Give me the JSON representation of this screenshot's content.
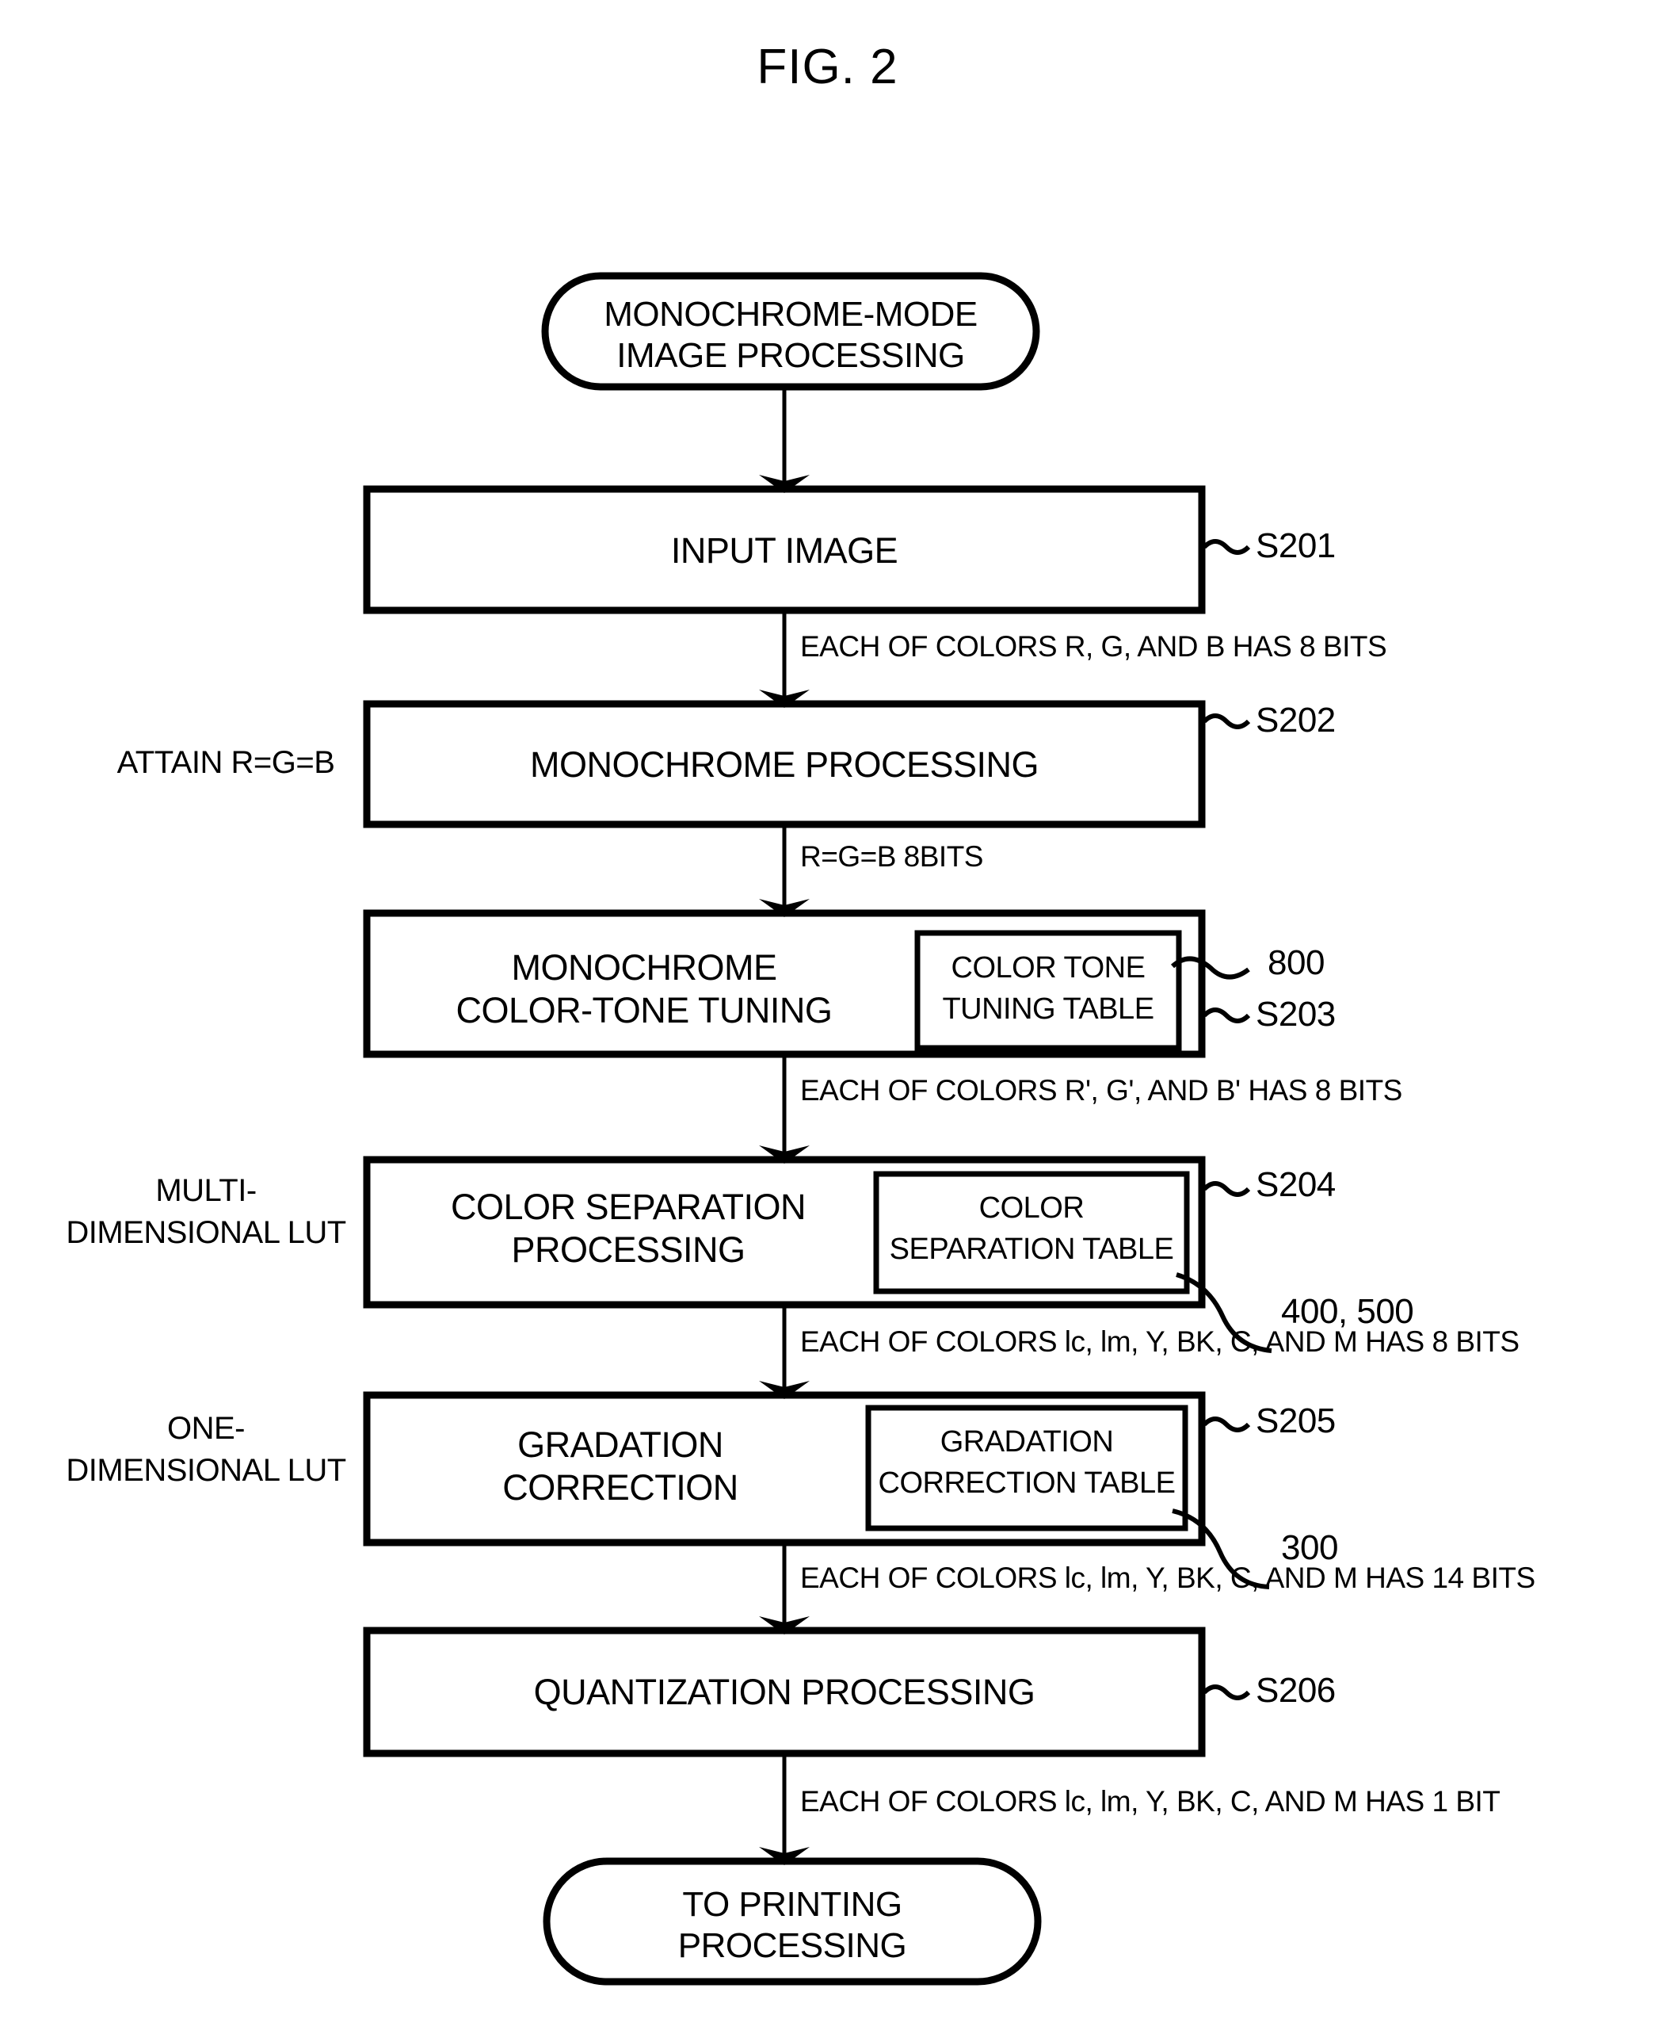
{
  "figure": {
    "title": "FIG. 2"
  },
  "nodes": {
    "start": {
      "label_line1": "MONOCHROME-MODE",
      "label_line2": "IMAGE PROCESSING"
    },
    "end": {
      "label_line1": "TO PRINTING",
      "label_line2": "PROCESSING"
    }
  },
  "steps": [
    {
      "id": "s201",
      "label_line1": "INPUT IMAGE",
      "label_line2": "",
      "ref": "S201",
      "side_label_line1": "",
      "side_label_line2": "",
      "table_line1": "",
      "table_line2": "",
      "table_ref": ""
    },
    {
      "id": "s202",
      "label_line1": "MONOCHROME PROCESSING",
      "label_line2": "",
      "ref": "S202",
      "side_label_line1": "ATTAIN R=G=B",
      "side_label_line2": "",
      "table_line1": "",
      "table_line2": "",
      "table_ref": ""
    },
    {
      "id": "s203",
      "label_line1": "MONOCHROME",
      "label_line2": "COLOR-TONE TUNING",
      "ref": "S203",
      "side_label_line1": "",
      "side_label_line2": "",
      "table_line1": "COLOR TONE",
      "table_line2": "TUNING TABLE",
      "table_ref": "800"
    },
    {
      "id": "s204",
      "label_line1": "COLOR SEPARATION",
      "label_line2": "PROCESSING",
      "ref": "S204",
      "side_label_line1": "MULTI-",
      "side_label_line2": "DIMENSIONAL LUT",
      "table_line1": "COLOR",
      "table_line2": "SEPARATION TABLE",
      "table_ref": "400, 500"
    },
    {
      "id": "s205",
      "label_line1": "GRADATION",
      "label_line2": "CORRECTION",
      "ref": "S205",
      "side_label_line1": "ONE-",
      "side_label_line2": "DIMENSIONAL LUT",
      "table_line1": "GRADATION",
      "table_line2": "CORRECTION TABLE",
      "table_ref": "300"
    },
    {
      "id": "s206",
      "label_line1": "QUANTIZATION PROCESSING",
      "label_line2": "",
      "ref": "S206",
      "side_label_line1": "",
      "side_label_line2": "",
      "table_line1": "",
      "table_line2": "",
      "table_ref": ""
    }
  ],
  "edge_labels": [
    {
      "id": "e1",
      "text": "EACH OF COLORS R, G, AND B HAS 8 BITS"
    },
    {
      "id": "e2",
      "text": "R=G=B 8BITS"
    },
    {
      "id": "e3",
      "text": "EACH OF COLORS R', G', AND B' HAS 8 BITS"
    },
    {
      "id": "e4",
      "text": "EACH OF COLORS lc, lm, Y, BK, C, AND M HAS 8 BITS"
    },
    {
      "id": "e5",
      "text": "EACH OF COLORS lc, lm, Y, BK, C, AND M HAS 14 BITS"
    },
    {
      "id": "e6",
      "text": "EACH OF COLORS lc, lm, Y, BK, C, AND M HAS 1 BIT"
    }
  ],
  "colors": {
    "ink": "#000000",
    "paper": "#ffffff"
  }
}
